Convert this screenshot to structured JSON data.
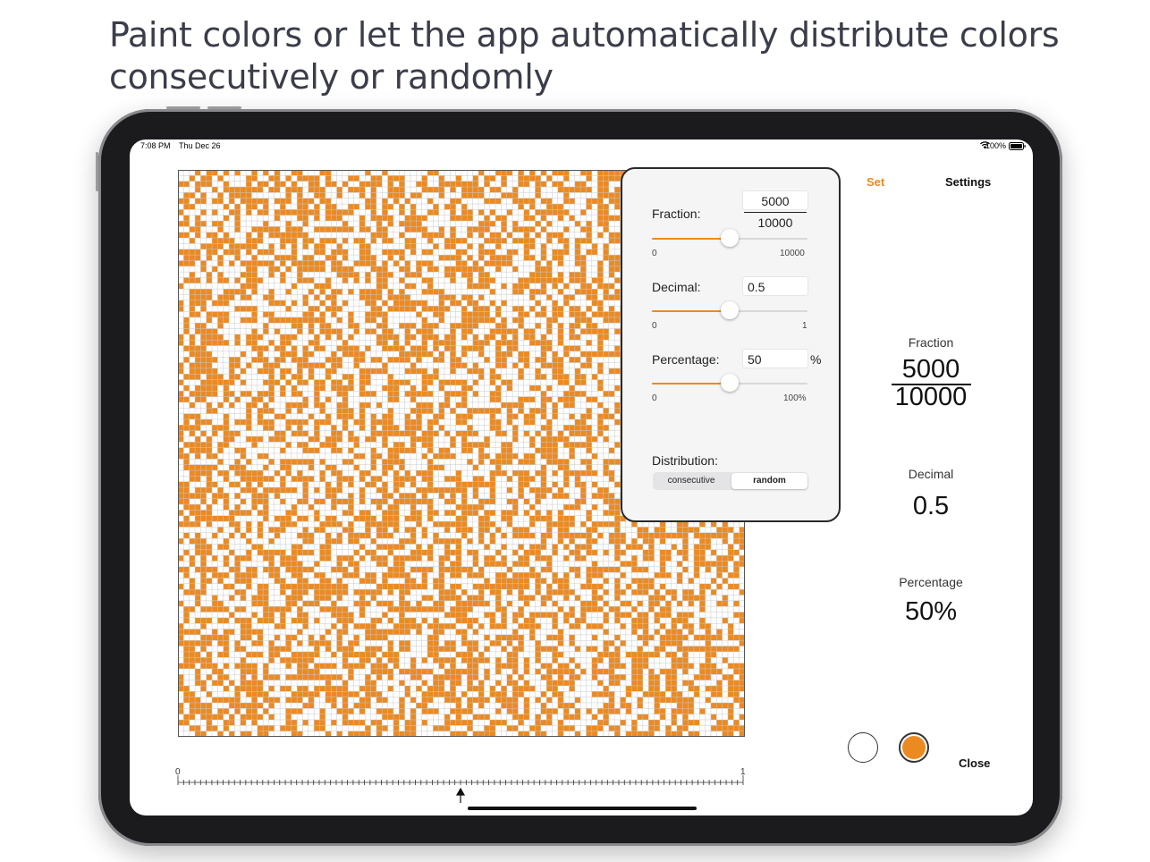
{
  "headline": {
    "line1": "Paint colors or let the app automatically distribute colors",
    "line2": "consecutively or randomly"
  },
  "status_bar": {
    "time": "7:08 PM",
    "date": "Thu Dec 26",
    "battery": "100%"
  },
  "colors": {
    "accent": "#ec8a22",
    "cell_filled": "#ec8a22",
    "cell_empty": "#ffffff",
    "grid_line": "#c9c9c9"
  },
  "grid": {
    "rows": 100,
    "cols": 100,
    "filled_fraction": 0.5,
    "distribution": "random"
  },
  "ruler": {
    "start_label": "0",
    "end_label": "1",
    "marker_value": 0.5
  },
  "popover": {
    "fraction_label": "Fraction:",
    "fraction_numerator": "5000",
    "fraction_denominator": "10000",
    "fraction_slider": {
      "min_label": "0",
      "max_label": "10000",
      "value": 0.5
    },
    "decimal_label": "Decimal:",
    "decimal_value": "0.5",
    "decimal_slider": {
      "min_label": "0",
      "max_label": "1",
      "value": 0.5
    },
    "percentage_label": "Percentage:",
    "percentage_value": "50",
    "percentage_unit": "%",
    "percentage_slider": {
      "min_label": "0",
      "max_label": "100%",
      "value": 0.5
    },
    "distribution_label": "Distribution:",
    "distribution_options": [
      "consecutive",
      "random"
    ],
    "distribution_selected": "random"
  },
  "nav": {
    "set_label": "Set",
    "settings_label": "Settings",
    "close_label": "Close"
  },
  "summary": {
    "fraction_title": "Fraction",
    "fraction_numerator": "5000",
    "fraction_denominator": "10000",
    "decimal_title": "Decimal",
    "decimal_value": "0.5",
    "percentage_title": "Percentage",
    "percentage_value": "50%"
  },
  "swatches": [
    {
      "name": "white",
      "color": "#ffffff"
    },
    {
      "name": "orange",
      "color": "#ec8a22",
      "selected": true
    }
  ]
}
